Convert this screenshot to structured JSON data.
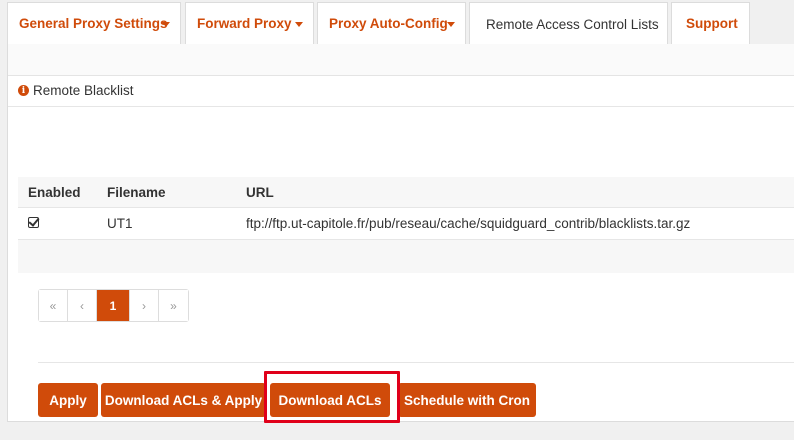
{
  "tabs": [
    {
      "label": "General Proxy Settings",
      "dropdown": true
    },
    {
      "label": "Forward Proxy",
      "dropdown": true
    },
    {
      "label": "Proxy Auto-Config",
      "dropdown": true
    },
    {
      "label": "Remote Access Control Lists",
      "dropdown": false,
      "active": true
    },
    {
      "label": "Support",
      "dropdown": false
    }
  ],
  "section": {
    "title": "Remote Blacklist",
    "icon": "info-icon"
  },
  "table": {
    "headers": [
      "Enabled",
      "Filename",
      "URL"
    ],
    "rows": [
      {
        "enabled": true,
        "filename": "UT1",
        "url": "ftp://ftp.ut-capitole.fr/pub/reseau/cache/squidguard_contrib/blacklists.tar.gz"
      }
    ]
  },
  "pagination": {
    "first": "«",
    "prev": "‹",
    "current": "1",
    "next": "›",
    "last": "»"
  },
  "buttons": {
    "apply": "Apply",
    "download_apply": "Download ACLs & Apply",
    "download": "Download ACLs",
    "schedule": "Schedule with Cron"
  },
  "colors": {
    "accent": "#d04b0a",
    "highlight": "#e0001a"
  }
}
